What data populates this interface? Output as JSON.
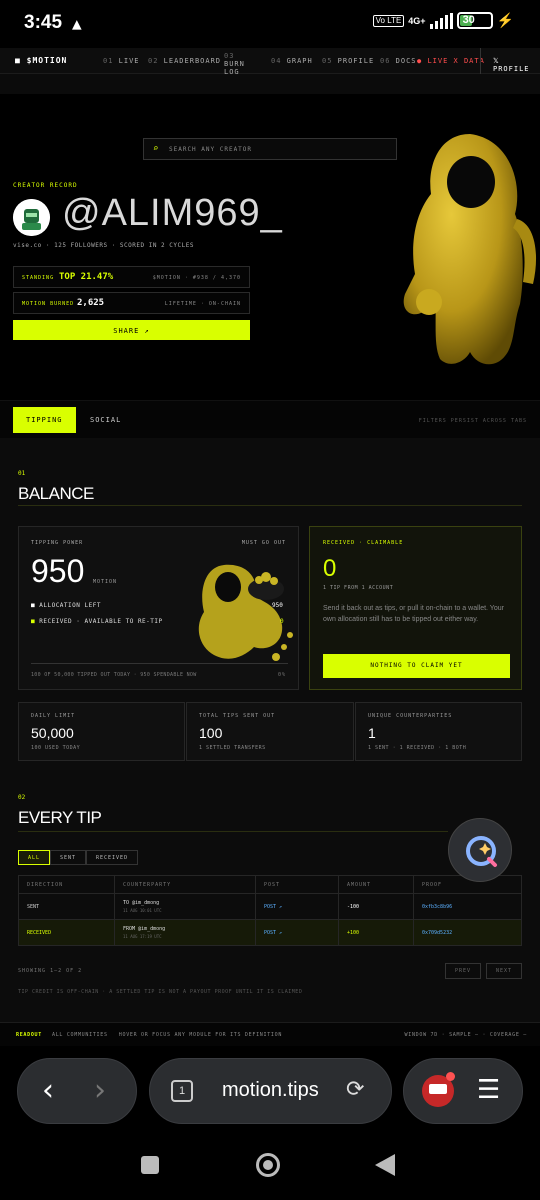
{
  "status": {
    "time": "3:45",
    "warning": "▲",
    "volte": "Vo LTE",
    "network": "4G+",
    "battery": "30"
  },
  "nav": {
    "brand": "$MOTION",
    "items": [
      {
        "num": "01",
        "label": "LIVE"
      },
      {
        "num": "02",
        "label": "LEADERBOARD"
      },
      {
        "num": "03",
        "label": "BURN LOG"
      },
      {
        "num": "04",
        "label": "GRAPH"
      },
      {
        "num": "05",
        "label": "PROFILE"
      },
      {
        "num": "06",
        "label": "DOCS"
      }
    ],
    "live": "LIVE X DATA",
    "profile": "PROFILE"
  },
  "hero": {
    "search_placeholder": "SEARCH ANY CREATOR",
    "section_label": "CREATOR RECORD",
    "handle": "@ALIM969_",
    "meta": "vise.co · 125 FOLLOWERS · SCORED IN 2 CYCLES",
    "standing": {
      "label": "STANDING",
      "value": "TOP 21.47%",
      "right": "$MOTION · #938 / 4,370"
    },
    "burned": {
      "label": "MOTION BURNED",
      "value": "2,625",
      "right": "LIFETIME · ON-CHAIN"
    },
    "share": "SHARE ↗"
  },
  "tabs": {
    "tipping": "TIPPING",
    "social": "SOCIAL",
    "note": "FILTERS PERSIST ACROSS TABS"
  },
  "balance": {
    "num": "01",
    "title": "BALANCE",
    "power": {
      "label": "TIPPING POWER",
      "must": "MUST GO OUT",
      "value": "950",
      "unit": "MOTION",
      "allocation_label": "ALLOCATION LEFT",
      "allocation_value": "950",
      "received_label": "RECEIVED · AVAILABLE TO RE-TIP",
      "received_value": "0",
      "footer": "100 OF 50,000 TIPPED OUT TODAY · 950 SPENDABLE NOW",
      "pct": "0%"
    },
    "claim": {
      "label": "RECEIVED · CLAIMABLE",
      "value": "0",
      "sub": "1 TIP FROM 1 ACCOUNT",
      "desc": "Send it back out as tips, or pull it on-chain to a wallet. Your own allocation still has to be tipped out either way.",
      "button": "NOTHING TO CLAIM YET"
    },
    "stats": [
      {
        "label": "DAILY LIMIT",
        "value": "50,000",
        "sub": "100 USED TODAY"
      },
      {
        "label": "TOTAL TIPS SENT OUT",
        "value": "100",
        "sub": "1 SETTLED TRANSFERS"
      },
      {
        "label": "UNIQUE COUNTERPARTIES",
        "value": "1",
        "sub": "1 SENT · 1 RECEIVED · 1 BOTH"
      }
    ]
  },
  "tips": {
    "num": "02",
    "title": "EVERY TIP",
    "filters": [
      "ALL",
      "SENT",
      "RECEIVED"
    ],
    "headers": [
      "DIRECTION",
      "COUNTERPARTY",
      "POST",
      "AMOUNT",
      "PROOF"
    ],
    "rows": [
      {
        "direction": "SENT",
        "party": "TO @im_dmong",
        "date": "11 AUG 10:01 UTC",
        "post": "POST ↗",
        "amount": "-100",
        "proof": "0xfb3c8b96"
      },
      {
        "direction": "RECEIVED",
        "party": "FROM @im_dmong",
        "date": "11 AUG 17:19 UTC",
        "post": "POST ↗",
        "amount": "+100",
        "proof": "0x709d5232"
      }
    ],
    "showing": "SHOWING 1–2 OF 2",
    "prev": "PREV",
    "next": "NEXT",
    "note": "TIP CREDIT IS OFF-CHAIN · A SETTLED TIP IS NOT A PAYOUT PROOF UNTIL IT IS CLAIMED"
  },
  "readout": {
    "label": "READOUT",
    "text": "ALL COMMUNITIES   HOVER OR FOCUS ANY MODULE FOR ITS DEFINITION",
    "right": "WINDOW 7D · SAMPLE — · COVERAGE —"
  },
  "browser": {
    "tab_count": "1",
    "url": "motion.tips"
  }
}
